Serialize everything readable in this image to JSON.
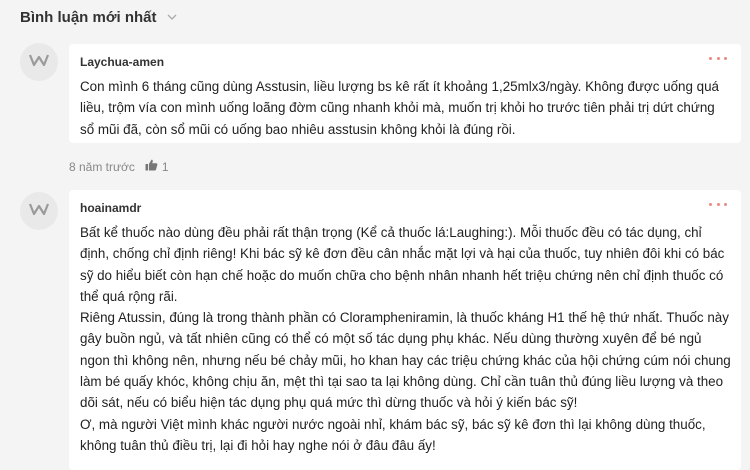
{
  "header": {
    "title": "Bình luận mới nhất",
    "chevron_icon": "chevron-down-icon"
  },
  "comments": [
    {
      "author": "Laychua-amen",
      "avatar_icon": "w-logo-icon",
      "more_icon": "more-dots-icon",
      "paragraphs": [
        "Con mình 6 tháng cũng dùng Asstusin, liều lượng bs kê rất ít khoảng 1,25mlx3/ngày. Không được uống quá liều, trộm vía con mình uống loãng đờm cũng nhanh khỏi mà, muốn trị khỏi ho trước tiên phải trị dứt chứng sổ mũi đã, còn sổ mũi có uống bao nhiêu asstusin không khỏi là đúng rồi."
      ],
      "time": "8 năm trước",
      "likes": "1",
      "like_icon": "thumbs-up-icon"
    },
    {
      "author": "hoainamdr",
      "avatar_icon": "w-logo-icon",
      "more_icon": "more-dots-icon",
      "paragraphs": [
        "Bất kể thuốc nào dùng đều phải rất thận trọng (Kể cả thuốc lá:Laughing:). Mỗi thuốc đều có tác dụng, chỉ định, chống chỉ định riêng! Khi bác sỹ kê đơn đều cân nhắc mặt lợi và hại của thuốc, tuy nhiên đôi khi có bác sỹ do hiểu biết còn hạn chế hoặc do muốn chữa cho bệnh nhân nhanh hết triệu chứng nên chỉ định thuốc có thể quá rộng rãi.",
        "Riêng Atussin, đúng là trong thành phần có Clorampheniramin, là thuốc kháng H1 thế hệ thứ nhất. Thuốc này gây buồn ngủ, và tất nhiên cũng có thể có một số tác dụng phụ khác. Nếu dùng thường xuyên để bé ngủ ngon thì không nên, nhưng nếu bé chảy mũi, ho khan hay các triệu chứng khác của hội chứng cúm nói chung làm bé quấy khóc, không chịu ăn, mệt thì tại sao ta lại không dùng. Chỉ cần tuân thủ đúng liều lượng và theo dõi sát, nếu có biểu hiện tác dụng phụ quá mức thì dừng thuốc và hỏi ý kiến bác sỹ!",
        "Ơ, mà người Việt mình khác người nước ngoài nhỉ, khám bác sỹ, bác sỹ kê đơn thì lại không dùng thuốc, không tuân thủ điều trị, lại đi hỏi hay nghe nói ở đâu đâu ấy!"
      ]
    }
  ]
}
